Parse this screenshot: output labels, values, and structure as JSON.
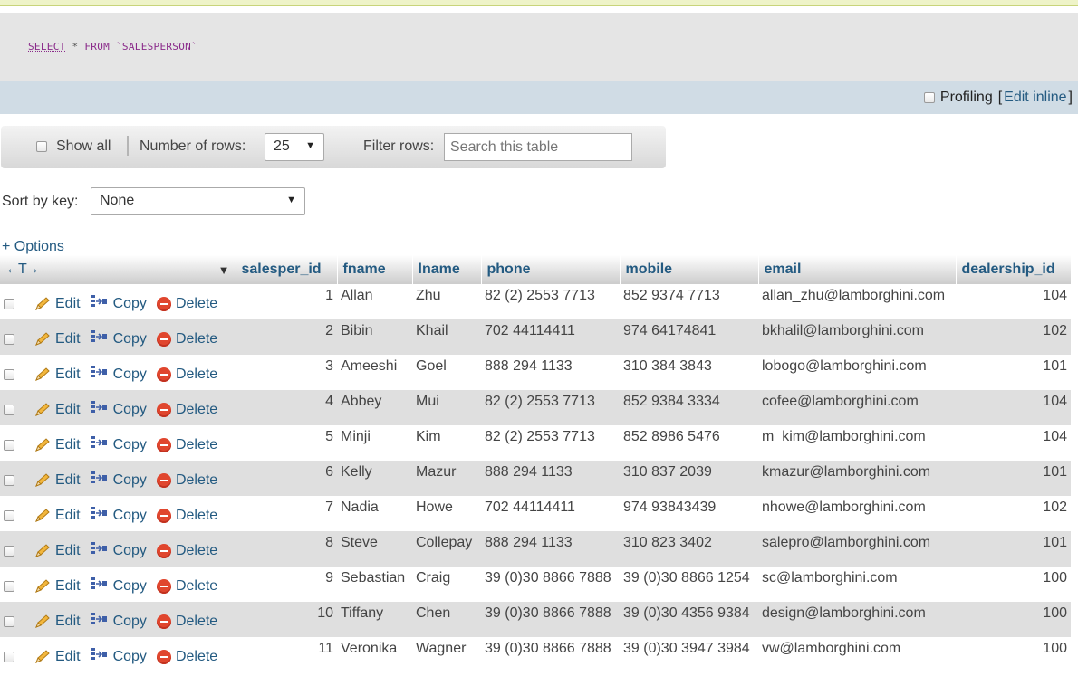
{
  "sql": {
    "select": "SELECT",
    "star": "*",
    "from": "FROM",
    "table": "`SALESPERSON`"
  },
  "profiling": {
    "label": "Profiling",
    "bracket_open": "[",
    "edit_inline": "Edit inline",
    "bracket_close": "]"
  },
  "navbar": {
    "show_all": "Show all",
    "rows_label": "Number of rows:",
    "rows_value": "25",
    "filter_label": "Filter rows:",
    "search_placeholder": "Search this table"
  },
  "sort": {
    "label": "Sort by key:",
    "value": "None"
  },
  "options_link": "+ Options",
  "table": {
    "col_control": "←T→",
    "headers": [
      "salesper_id",
      "fname",
      "lname",
      "phone",
      "mobile",
      "email",
      "dealership_id"
    ],
    "action_edit": "Edit",
    "action_copy": "Copy",
    "action_delete": "Delete",
    "rows": [
      {
        "id": "1",
        "fname": "Allan",
        "lname": "Zhu",
        "phone": "82 (2) 2553 7713",
        "mobile": "852 9374 7713",
        "email": "allan_zhu@lamborghini.com",
        "dealership": "104"
      },
      {
        "id": "2",
        "fname": "Bibin",
        "lname": "Khail",
        "phone": "702 44114411",
        "mobile": "974 64174841",
        "email": "bkhalil@lamborghini.com",
        "dealership": "102"
      },
      {
        "id": "3",
        "fname": "Ameeshi",
        "lname": "Goel",
        "phone": "888 294 1133",
        "mobile": "310 384 3843",
        "email": "lobogo@lamborghini.com",
        "dealership": "101"
      },
      {
        "id": "4",
        "fname": "Abbey",
        "lname": "Mui",
        "phone": "82 (2) 2553 7713",
        "mobile": "852 9384 3334",
        "email": "cofee@lamborghini.com",
        "dealership": "104"
      },
      {
        "id": "5",
        "fname": "Minji",
        "lname": "Kim",
        "phone": "82 (2) 2553 7713",
        "mobile": "852 8986 5476",
        "email": "m_kim@lamborghini.com",
        "dealership": "104"
      },
      {
        "id": "6",
        "fname": "Kelly",
        "lname": "Mazur",
        "phone": "888 294 1133",
        "mobile": "310 837 2039",
        "email": "kmazur@lamborghini.com",
        "dealership": "101"
      },
      {
        "id": "7",
        "fname": "Nadia",
        "lname": "Howe",
        "phone": "702 44114411",
        "mobile": "974 93843439",
        "email": "nhowe@lamborghini.com",
        "dealership": "102"
      },
      {
        "id": "8",
        "fname": "Steve",
        "lname": "Collepay",
        "phone": "888 294 1133",
        "mobile": "310 823 3402",
        "email": "salepro@lamborghini.com",
        "dealership": "101"
      },
      {
        "id": "9",
        "fname": "Sebastian",
        "lname": "Craig",
        "phone": "39 (0)30 8866 7888",
        "mobile": "39 (0)30 8866 1254",
        "email": "sc@lamborghini.com",
        "dealership": "100"
      },
      {
        "id": "10",
        "fname": "Tiffany",
        "lname": "Chen",
        "phone": "39 (0)30 8866 7888",
        "mobile": "39 (0)30 4356 9384",
        "email": "design@lamborghini.com",
        "dealership": "100"
      },
      {
        "id": "11",
        "fname": "Veronika",
        "lname": "Wagner",
        "phone": "39 (0)30 8866 7888",
        "mobile": "39 (0)30 3947 3984",
        "email": "vw@lamborghini.com",
        "dealership": "100"
      }
    ]
  },
  "colors": {
    "link": "#235a81",
    "row_alt": "#dfdfdf",
    "profiling_bar": "#d0dce5",
    "delete_icon": "#e0462e"
  }
}
